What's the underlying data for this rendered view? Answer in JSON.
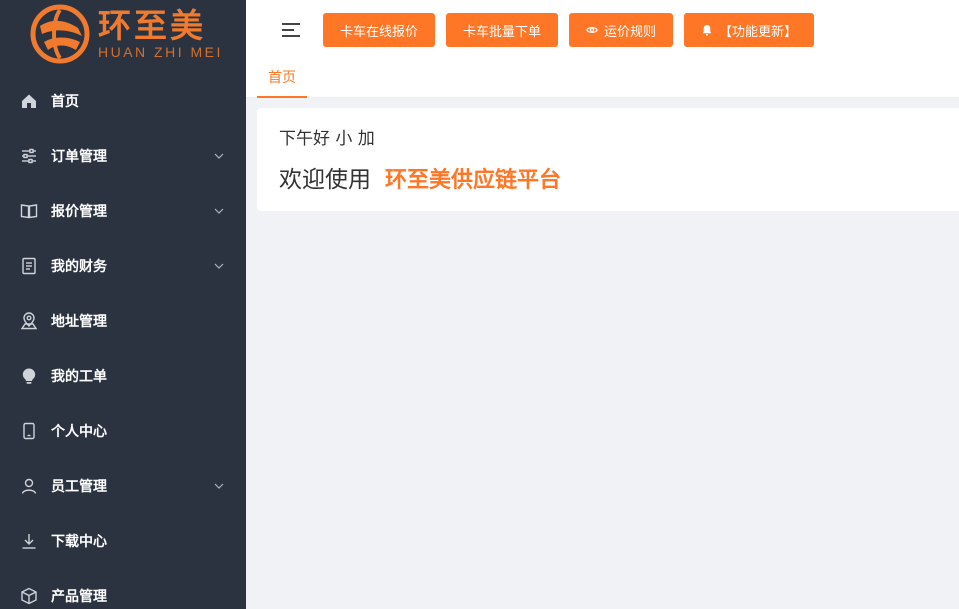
{
  "logo": {
    "cn": "环至美",
    "en": "HUAN ZHI MEI"
  },
  "sidebar": {
    "items": [
      {
        "label": "首页",
        "icon": "home-icon",
        "has_submenu": false
      },
      {
        "label": "订单管理",
        "icon": "sliders-icon",
        "has_submenu": true
      },
      {
        "label": "报价管理",
        "icon": "book-icon",
        "has_submenu": true
      },
      {
        "label": "我的财务",
        "icon": "document-icon",
        "has_submenu": true
      },
      {
        "label": "地址管理",
        "icon": "map-pin-icon",
        "has_submenu": false
      },
      {
        "label": "我的工单",
        "icon": "bulb-icon",
        "has_submenu": false
      },
      {
        "label": "个人中心",
        "icon": "phone-icon",
        "has_submenu": false
      },
      {
        "label": "员工管理",
        "icon": "user-icon",
        "has_submenu": true
      },
      {
        "label": "下载中心",
        "icon": "download-icon",
        "has_submenu": false
      },
      {
        "label": "产品管理",
        "icon": "box-icon",
        "has_submenu": false
      }
    ]
  },
  "toolbar": {
    "buttons": [
      {
        "label": "卡车在线报价",
        "icon": ""
      },
      {
        "label": "卡车批量下单",
        "icon": ""
      },
      {
        "label": "运价规则",
        "icon": "eye-icon"
      },
      {
        "label": "【功能更新】",
        "icon": "bell-icon"
      }
    ]
  },
  "tabs": [
    {
      "label": "首页",
      "active": true
    }
  ],
  "welcome": {
    "greeting": "下午好 小 加",
    "prefix": "欢迎使用",
    "brand": "环至美供应链平台"
  },
  "colors": {
    "accent": "#ff7626",
    "sidebar_bg": "#2b3340",
    "page_bg": "#f0f2f5"
  }
}
